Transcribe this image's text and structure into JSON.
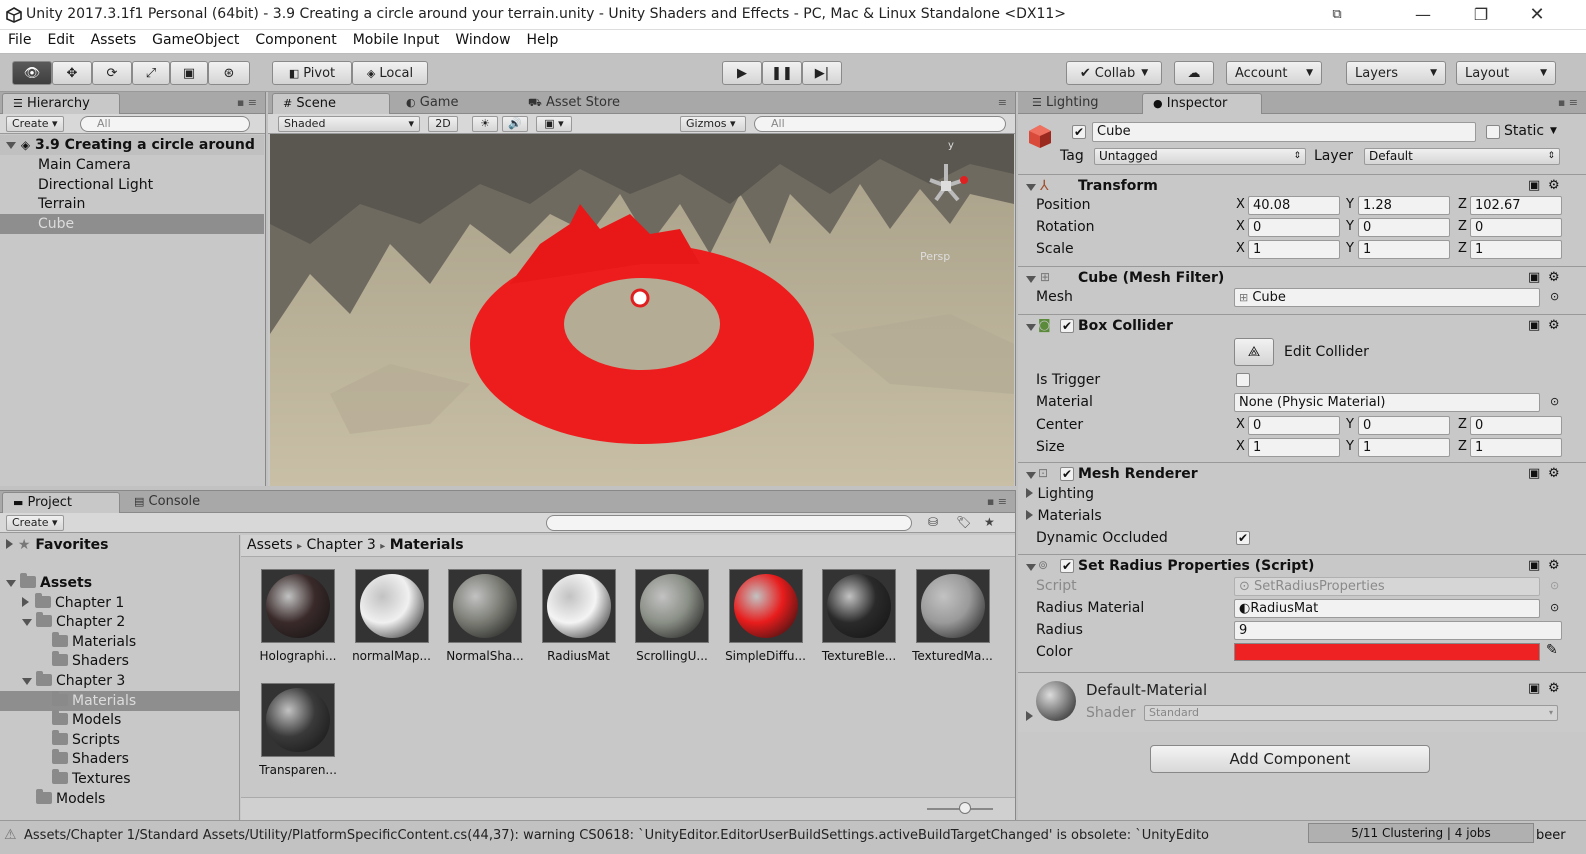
{
  "titlebar": {
    "title": "Unity 2017.3.1f1 Personal (64bit) - 3.9 Creating a circle around your terrain.unity - Unity Shaders and Effects - PC, Mac & Linux Standalone <DX11>"
  },
  "menu": [
    "File",
    "Edit",
    "Assets",
    "GameObject",
    "Component",
    "Mobile Input",
    "Window",
    "Help"
  ],
  "toolbar": {
    "pivot": "Pivot",
    "local": "Local",
    "collab": "Collab",
    "account": "Account",
    "layers": "Layers",
    "layout": "Layout"
  },
  "hierarchy": {
    "tab": "Hierarchy",
    "create": "Create",
    "search_placeholder": "All",
    "scene": "3.9 Creating a circle around",
    "items": [
      "Main Camera",
      "Directional Light",
      "Terrain",
      "Cube"
    ],
    "selected": "Cube"
  },
  "scene": {
    "tabs": [
      "Scene",
      "Game",
      "Asset Store"
    ],
    "shaded": "Shaded",
    "mode_2d": "2D",
    "gizmos": "Gizmos",
    "search_placeholder": "All",
    "persp_label": "Persp",
    "gizmo_y": "y",
    "ring_color": "#ff2020"
  },
  "project": {
    "tabs": [
      "Project",
      "Console"
    ],
    "create": "Create",
    "favorites": "Favorites",
    "tree": [
      {
        "label": "Assets",
        "indent": 0,
        "expanded": true,
        "bold": true
      },
      {
        "label": "Chapter 1",
        "indent": 1,
        "expanded": false
      },
      {
        "label": "Chapter 2",
        "indent": 1,
        "expanded": true
      },
      {
        "label": "Materials",
        "indent": 2
      },
      {
        "label": "Shaders",
        "indent": 2
      },
      {
        "label": "Chapter 3",
        "indent": 1,
        "expanded": true
      },
      {
        "label": "Materials",
        "indent": 2,
        "selected": true
      },
      {
        "label": "Models",
        "indent": 2
      },
      {
        "label": "Scripts",
        "indent": 2
      },
      {
        "label": "Shaders",
        "indent": 2
      },
      {
        "label": "Textures",
        "indent": 2
      },
      {
        "label": "Models",
        "indent": 1
      }
    ],
    "breadcrumb": [
      "Assets",
      "Chapter 3",
      "Materials"
    ],
    "assets": [
      {
        "label": "Holographi...",
        "color": "#3a2a2a"
      },
      {
        "label": "normalMap...",
        "color": "#f0f0f0"
      },
      {
        "label": "NormalSha...",
        "color": "#7a7c74"
      },
      {
        "label": "RadiusMat",
        "color": "#f4f4f4"
      },
      {
        "label": "ScrollingU...",
        "color": "#8a8f86"
      },
      {
        "label": "SimpleDiffu...",
        "color": "#e81c1c"
      },
      {
        "label": "TextureBle...",
        "color": "#2a2a2a"
      },
      {
        "label": "TexturedMa...",
        "color": "#9a9a9a"
      },
      {
        "label": "Transparen...",
        "color": "#3a3a3a"
      }
    ]
  },
  "inspector": {
    "tabs": [
      "Lighting",
      "Inspector"
    ],
    "object_name": "Cube",
    "static_label": "Static",
    "tag_label": "Tag",
    "tag_value": "Untagged",
    "layer_label": "Layer",
    "layer_value": "Default",
    "transform": {
      "title": "Transform",
      "position_label": "Position",
      "rotation_label": "Rotation",
      "scale_label": "Scale",
      "position": [
        "40.08",
        "1.28",
        "102.67"
      ],
      "rotation": [
        "0",
        "0",
        "0"
      ],
      "scale": [
        "1",
        "1",
        "1"
      ]
    },
    "mesh_filter": {
      "title": "Cube (Mesh Filter)",
      "mesh_label": "Mesh",
      "mesh_value": "Cube"
    },
    "box_collider": {
      "title": "Box Collider",
      "edit_collider": "Edit Collider",
      "is_trigger_label": "Is Trigger",
      "material_label": "Material",
      "material_value": "None (Physic Material)",
      "center_label": "Center",
      "center": [
        "0",
        "0",
        "0"
      ],
      "size_label": "Size",
      "size": [
        "1",
        "1",
        "1"
      ]
    },
    "mesh_renderer": {
      "title": "Mesh Renderer",
      "lighting": "Lighting",
      "materials": "Materials",
      "dynamic_occluded": "Dynamic Occluded"
    },
    "script_comp": {
      "title": "Set Radius Properties (Script)",
      "script_label": "Script",
      "script_value": "SetRadiusProperties",
      "radius_material_label": "Radius Material",
      "radius_material_value": "RadiusMat",
      "radius_label": "Radius",
      "radius_value": "9",
      "color_label": "Color",
      "color_value": "#ee2222"
    },
    "material": {
      "name": "Default-Material",
      "shader_label": "Shader",
      "shader_value": "Standard"
    },
    "add_component": "Add Component"
  },
  "status": {
    "message": "Assets/Chapter 1/Standard Assets/Utility/PlatformSpecificContent.cs(44,37): warning CS0618: `UnityEditor.EditorUserBuildSettings.activeBuildTargetChanged' is obsolete: `UnityEdito",
    "progress": "5/11 Clustering | 4 jobs",
    "tail": "beer"
  }
}
